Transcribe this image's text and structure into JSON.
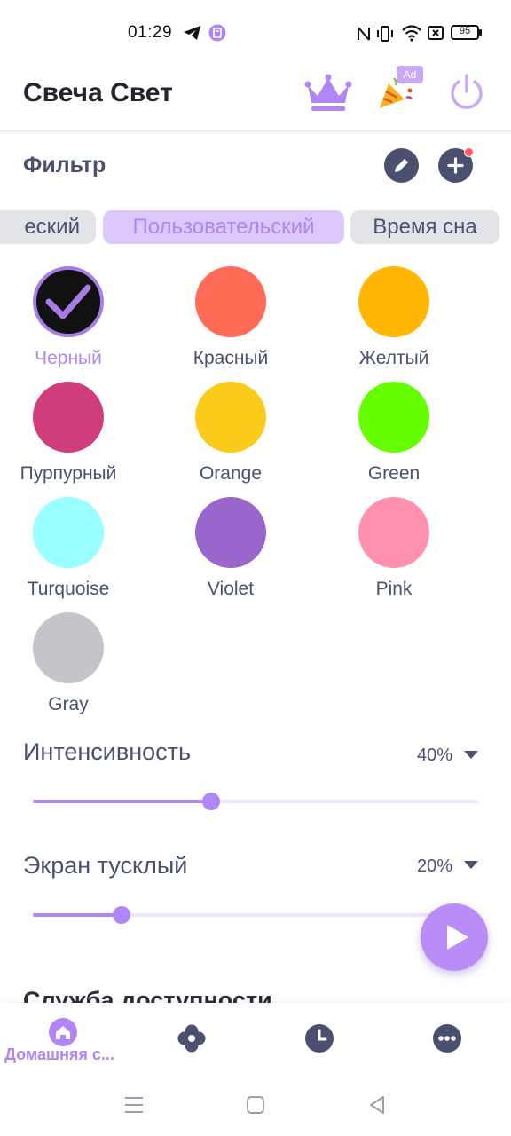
{
  "status_bar": {
    "time": "01:29",
    "battery": "95",
    "icons": [
      "telegram-icon",
      "app-notification-icon",
      "nfc-icon",
      "vibrate-icon",
      "wifi-icon",
      "sim-off-icon",
      "battery-icon"
    ]
  },
  "header": {
    "title": "Свеча Свет",
    "ad_badge": "Ad",
    "icons": [
      "crown-icon",
      "party-popper-icon",
      "power-icon"
    ]
  },
  "filter": {
    "title": "Фильтр",
    "icons": [
      "edit-icon",
      "add-icon"
    ],
    "tabs": [
      {
        "label": "Классический",
        "visible_text": "еский",
        "active": false
      },
      {
        "label": "Пользовательский",
        "active": true
      },
      {
        "label": "Время сна",
        "active": false
      }
    ],
    "colors": [
      {
        "label": "Черный",
        "hex": "#111111",
        "selected": true
      },
      {
        "label": "Красный",
        "hex": "#ff6b57",
        "selected": false
      },
      {
        "label": "Желтый",
        "hex": "#ffb703",
        "selected": false
      },
      {
        "label": "Пурпурный",
        "hex": "#d03d7c",
        "selected": false
      },
      {
        "label": "Orange",
        "hex": "#facb1a",
        "selected": false
      },
      {
        "label": "Green",
        "hex": "#66ff00",
        "selected": false
      },
      {
        "label": "Turquoise",
        "hex": "#99ffff",
        "selected": false
      },
      {
        "label": "Violet",
        "hex": "#9966cc",
        "selected": false
      },
      {
        "label": "Pink",
        "hex": "#ff91ae",
        "selected": false
      },
      {
        "label": "Gray",
        "hex": "#c4c5ca",
        "selected": false
      }
    ]
  },
  "sliders": {
    "intensity": {
      "label": "Интенсивность",
      "value": "40%",
      "fraction": 0.4
    },
    "dim": {
      "label": "Экран тусклый",
      "value": "20%",
      "fraction": 0.2
    }
  },
  "partial_section_title": "Служба доступности",
  "bottom_nav": {
    "items": [
      {
        "label": "Домашняя с...",
        "icon": "home-icon",
        "active": true
      },
      {
        "label": "",
        "icon": "flower-icon",
        "active": false
      },
      {
        "label": "",
        "icon": "clock-icon",
        "active": false
      },
      {
        "label": "",
        "icon": "more-icon",
        "active": false
      }
    ]
  },
  "colors": {
    "accent": "#b085f5",
    "text": "#4a5070"
  }
}
